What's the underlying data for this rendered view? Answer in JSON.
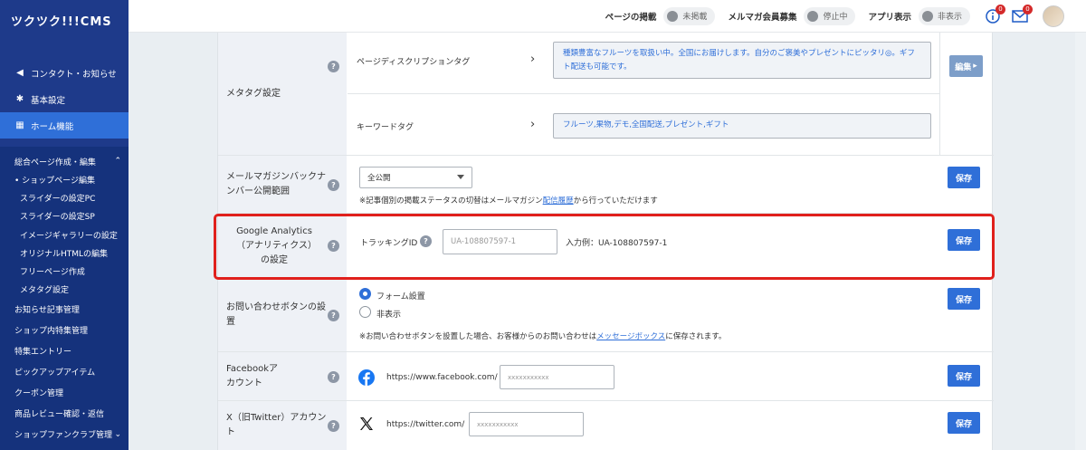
{
  "app": {
    "logo": "ツクツク!!!CMS"
  },
  "sidebar": {
    "items": [
      {
        "icon": "megaphone-icon",
        "glyph": "◀",
        "label": "コンタクト・お知らせ"
      },
      {
        "icon": "gear-icon",
        "glyph": "✱",
        "label": "基本設定"
      },
      {
        "icon": "home-icon",
        "glyph": "▦",
        "label": "ホーム機能"
      }
    ],
    "section": {
      "label": "総合ページ作成・編集",
      "chevron": "⌃"
    },
    "sub_items": [
      "• ショップページ編集",
      "スライダーの設定PC",
      "スライダーの設定SP",
      "イメージギャラリーの設定",
      "オリジナルHTMLの編集",
      "フリーページ作成",
      "メタタグ設定"
    ],
    "top_items": [
      "お知らせ記事管理",
      "ショップ内特集管理",
      "特集エントリー",
      "ピックアップアイテム",
      "クーポン管理",
      "商品レビュー確認・返信"
    ],
    "last_item": {
      "label": "ショップファンクラブ管理",
      "chevron": "⌄"
    }
  },
  "header": {
    "page_publish_label": "ページの掲載",
    "page_publish_status": "未掲載",
    "mailmag_label": "メルマガ会員募集",
    "mailmag_status": "停止中",
    "app_label": "アプリ表示",
    "app_status": "非表示",
    "info_badge": "0",
    "mail_badge": "0"
  },
  "meta": {
    "label": "メタタグ設定",
    "desc_label": "ページディスクリプションタグ",
    "desc_value": "種類豊富なフルーツを取扱い中。全国にお届けします。自分のご褒美やプレゼントにピッタリ◎。ギフト配送も可能です。",
    "kw_label": "キーワードタグ",
    "kw_value": "フルーツ,果物,デモ,全国配送,プレゼント,ギフト",
    "edit_button": "編集",
    "chevron": "›"
  },
  "mailmag": {
    "label": "メールマガジンバックナンバー公開範囲",
    "select_value": "全公開",
    "note_before": "※記事個別の掲載ステータスの切替はメールマガジン",
    "note_link": "配信履歴",
    "note_after": "から行っていただけます",
    "save": "保存"
  },
  "ga": {
    "label": "Google Analytics（アナリティクス）の設定",
    "tracking_label": "トラッキングID",
    "placeholder": "UA-108807597-1",
    "example": "入力例：UA-108807597-1",
    "save": "保存"
  },
  "contact": {
    "label": "お問い合わせボタンの設置",
    "option_on": "フォーム設置",
    "option_off": "非表示",
    "note_before": "※お問い合わせボタンを設置した場合、お客様からのお問い合わせは",
    "note_link": "メッセージボックス",
    "note_after": "に保存されます。",
    "save": "保存"
  },
  "facebook": {
    "label": "Facebookアカウント",
    "url": "https://www.facebook.com/",
    "placeholder": "xxxxxxxxxxx",
    "save": "保存"
  },
  "twitter": {
    "label": "X（旧Twitter）アカウント",
    "url": "https://twitter.com/",
    "placeholder": "xxxxxxxxxxx",
    "save": "保存"
  },
  "help_glyph": "?"
}
